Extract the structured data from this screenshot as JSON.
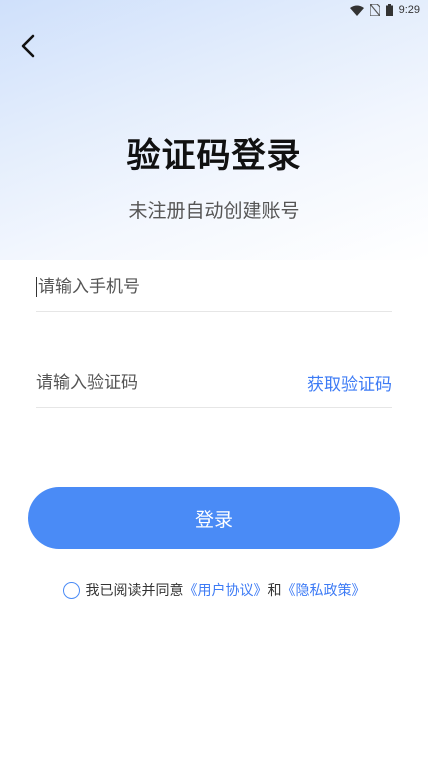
{
  "status_bar": {
    "time": "9:29",
    "icons": [
      "wifi-icon",
      "no-sim-icon",
      "battery-icon"
    ]
  },
  "header": {
    "back_icon": "back-arrow-icon"
  },
  "title": "验证码登录",
  "subtitle": "未注册自动创建账号",
  "phone_field": {
    "value": "",
    "placeholder": "请输入手机号"
  },
  "code_field": {
    "value": "",
    "placeholder": "请输入验证码",
    "get_code_label": "获取验证码"
  },
  "login_button": {
    "label": "登录"
  },
  "agreement": {
    "checked": false,
    "prefix": "我已阅读并同意",
    "user_agreement": "《用户协议》",
    "conjunction": "和",
    "privacy_policy": "《隐私政策》"
  },
  "colors": {
    "accent": "#4a8bf6",
    "link": "#3d7bf5",
    "gradient_top": "#cfe0fb"
  }
}
